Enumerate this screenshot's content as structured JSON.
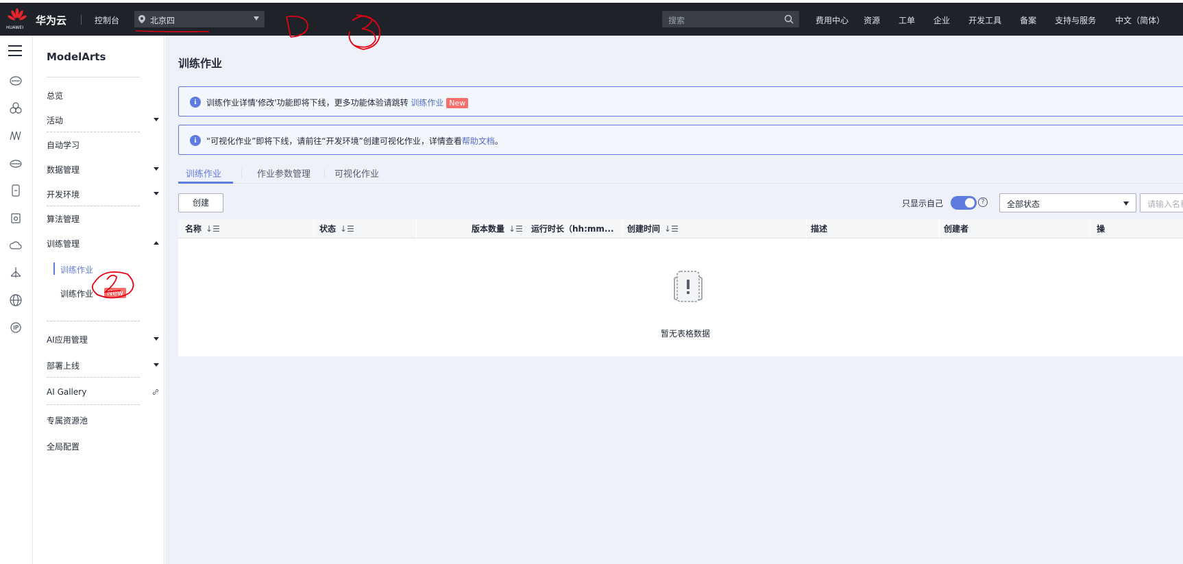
{
  "topbar": {
    "logo_text": "HUAWEI",
    "brand": "华为云",
    "console": "控制台",
    "region": "北京四",
    "search_placeholder": "搜索",
    "nav": [
      "费用中心",
      "资源",
      "工单",
      "企业",
      "开发工具",
      "备案",
      "支持与服务",
      "中文（简体）"
    ]
  },
  "sidebar": {
    "title": "ModelArts",
    "items": [
      {
        "label": "总览"
      },
      {
        "label": "活动"
      },
      {
        "label": "自动学习"
      },
      {
        "label": "数据管理"
      },
      {
        "label": "开发环境"
      },
      {
        "label": "算法管理"
      },
      {
        "label": "训练管理"
      },
      {
        "label": "AI应用管理"
      },
      {
        "label": "部署上线"
      },
      {
        "label": "AI Gallery"
      },
      {
        "label": "专属资源池"
      },
      {
        "label": "全局配置"
      }
    ],
    "sub_items": [
      {
        "label": "训练作业"
      },
      {
        "label": "训练作业",
        "badge": "New"
      }
    ]
  },
  "main": {
    "title": "训练作业",
    "alert1": {
      "text": "训练作业详情'修改'功能即将下线，更多功能体验请跳转 ",
      "link": "训练作业",
      "badge": "New"
    },
    "alert2": {
      "text": "“可视化作业”即将下线，请前往“开发环境”创建可视化作业，详情查看",
      "link": "帮助文档",
      "suffix": "。"
    },
    "tabs": [
      "训练作业",
      "作业参数管理",
      "可视化作业"
    ],
    "create_button": "创建",
    "only_mine": "只显示自己",
    "help": "?",
    "status_select": "全部状态",
    "name_placeholder": "请输入名称",
    "columns": [
      "名称",
      "状态",
      "版本数量",
      "运行时长（hh:mm...",
      "创建时间",
      "描述",
      "创建者",
      "操"
    ],
    "empty_text": "暂无表格数据"
  },
  "colors": {
    "accent": "#5e7ce0",
    "topbar": "#1f2329",
    "main_bg": "#eef1fa",
    "badge": "#f66f6a"
  }
}
